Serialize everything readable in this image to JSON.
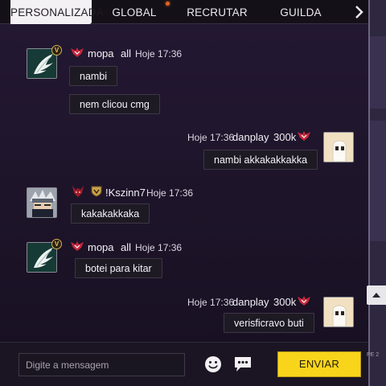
{
  "tabs": [
    {
      "label": "PERSONALIZADA",
      "active": true
    },
    {
      "label": "GLOBAL",
      "active": false
    },
    {
      "label": "RECRUTAR",
      "active": false
    },
    {
      "label": "GUILDA",
      "active": false
    }
  ],
  "tab_more_icon": "chevron-right-icon",
  "messages": [
    {
      "side": "left",
      "username": "mopa",
      "tag": "all",
      "time": "Hoje 17:36",
      "badge": "V",
      "avatar_icon": "wing-icon",
      "rank_icon": "winged-emblem-icon",
      "bubbles": [
        "nambi",
        "nem clicou cmg"
      ]
    },
    {
      "side": "right",
      "username": "danplay",
      "tag": "300k",
      "time": "Hoje 17:36",
      "avatar_icon": "ghost-icon",
      "rank_icon": "winged-emblem-icon",
      "bubbles": [
        "nambi akkakakkakka"
      ]
    },
    {
      "side": "left",
      "username": "!Kszinn7",
      "tag": "",
      "time": "Hoje 17:36",
      "avatar_icon": "ninja-icon",
      "rank_icon": "demon-emblem-icon",
      "guild_icon": "guild-shield-icon",
      "bubbles": [
        "kakakakkaka"
      ]
    },
    {
      "side": "left",
      "username": "mopa",
      "tag": "all",
      "time": "Hoje 17:36",
      "badge": "V",
      "avatar_icon": "wing-icon",
      "rank_icon": "winged-emblem-icon",
      "bubbles": [
        "botei para kitar"
      ]
    },
    {
      "side": "right",
      "username": "danplay",
      "tag": "300k",
      "time": "Hoje 17:36",
      "avatar_icon": "ghost-icon",
      "rank_icon": "winged-emblem-icon",
      "bubbles": [
        "verisficravo buti"
      ]
    }
  ],
  "input": {
    "placeholder": "Digite a mensagem",
    "value": ""
  },
  "icons": {
    "emoji": "smiley-icon",
    "quick_chat": "speech-bubble-icon"
  },
  "send_label": "ENVIAR",
  "side_label": "PE 2",
  "colors": {
    "send_button": "#f8d51b",
    "active_tab": "#f3f1f4",
    "rank_red": "#c8283c"
  }
}
